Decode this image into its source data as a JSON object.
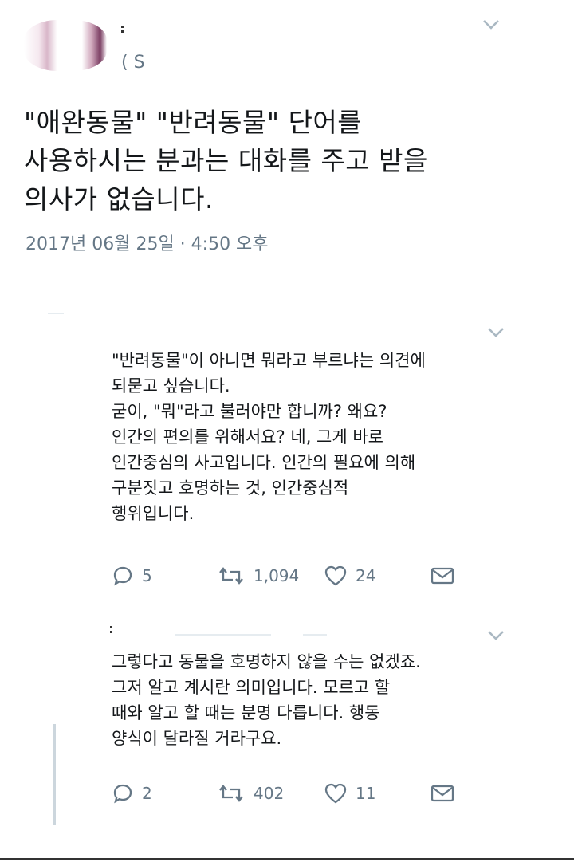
{
  "main_tweet": {
    "handle": "( S",
    "text": "\"애완동물\" \"반려동물\" 단어를\n사용하시는 분과는 대화를 주고 받을\n의사가 없습니다.",
    "timestamp": "2017년 06월 25일 · 4:50 오후"
  },
  "reply_1": {
    "text": "\"반려동물\"이 아니면 뭐라고 부르냐는 의견에\n되묻고 싶습니다.\n굳이, \"뭐\"라고 불러야만 합니까? 왜요?\n인간의 편의를 위해서요? 네, 그게 바로\n인간중심의 사고입니다. 인간의 필요에 의해\n구분짓고 호명하는 것, 인간중심적\n행위입니다.",
    "replies": "5",
    "retweets": "1,094",
    "likes": "24"
  },
  "reply_2": {
    "text": "그렇다고 동물을 호명하지 않을 수는 없겠죠.\n그저 알고 계시란 의미입니다. 모르고 할\n때와 알고 할 때는 분명 다릅니다. 행동\n양식이 달라질 거라구요.",
    "replies": "2",
    "retweets": "402",
    "likes": "11"
  },
  "icons": {
    "chevron": "chevron-down-icon",
    "reply": "reply-icon",
    "retweet": "retweet-icon",
    "like": "heart-icon",
    "dm": "mail-icon"
  },
  "colors": {
    "text": "#14171a",
    "secondary": "#657786",
    "divider": "#e6ecf0"
  }
}
